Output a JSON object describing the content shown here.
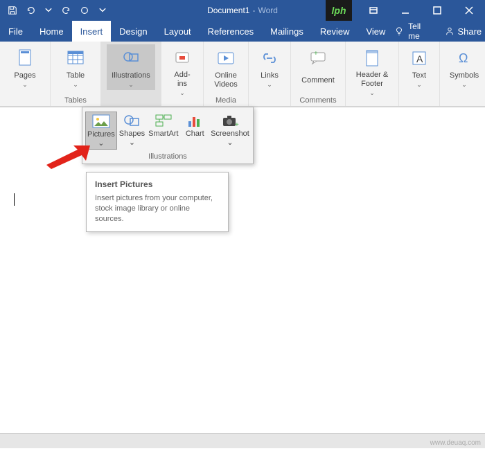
{
  "title": {
    "doc_name": "Document1",
    "app": "Word",
    "separator": " - "
  },
  "logo_text": "lph",
  "tabs": {
    "file": "File",
    "home": "Home",
    "insert": "Insert",
    "design": "Design",
    "layout": "Layout",
    "references": "References",
    "mailings": "Mailings",
    "review": "Review",
    "view": "View",
    "tell_me": "Tell me",
    "share": "Share"
  },
  "ribbon": {
    "pages": {
      "label": "Pages",
      "btn": "Pages"
    },
    "tables": {
      "label": "Tables",
      "btn": "Table"
    },
    "illustrations": {
      "label": "Illustrations",
      "btn": "Illustrations"
    },
    "addins": {
      "btn": "Add-\nins"
    },
    "media": {
      "label": "Media",
      "btn": "Online\nVideos"
    },
    "links": {
      "btn": "Links"
    },
    "comments": {
      "label": "Comments",
      "btn": "Comment"
    },
    "headerfooter": {
      "btn": "Header &\nFooter"
    },
    "text": {
      "btn": "Text"
    },
    "symbols": {
      "btn": "Symbols"
    }
  },
  "flyout": {
    "pictures": "Pictures",
    "shapes": "Shapes",
    "smartart": "SmartArt",
    "chart": "Chart",
    "screenshot": "Screenshot",
    "group_label": "Illustrations"
  },
  "tooltip": {
    "title": "Insert Pictures",
    "body": "Insert pictures from your computer, stock image library or online sources."
  },
  "watermark": "www.deuaq.com"
}
